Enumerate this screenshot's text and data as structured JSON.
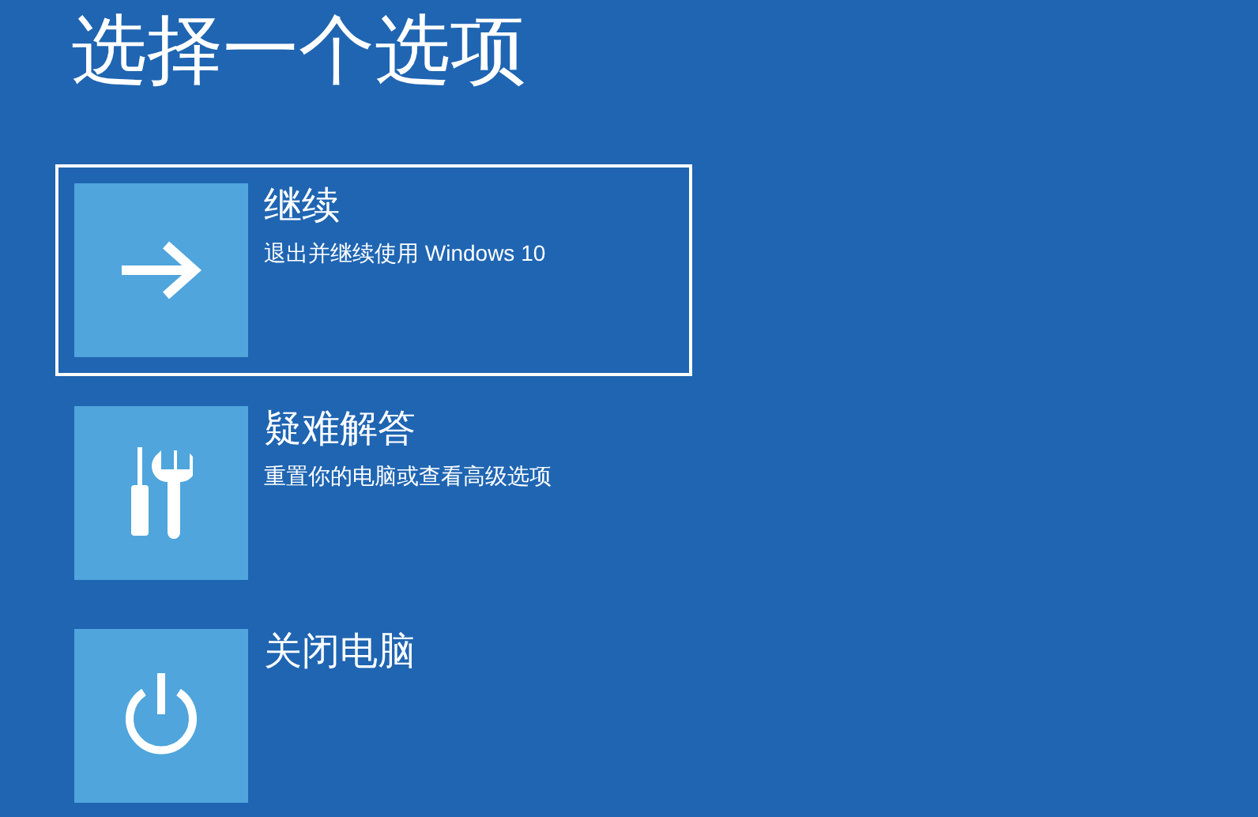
{
  "title": "选择一个选项",
  "options": [
    {
      "kind": "continue",
      "title": "继续",
      "subtitle": "退出并继续使用 Windows 10",
      "selected": true
    },
    {
      "kind": "troubleshoot",
      "title": "疑难解答",
      "subtitle": "重置你的电脑或查看高级选项",
      "selected": false
    },
    {
      "kind": "power",
      "title": "关闭电脑",
      "selected": false
    }
  ]
}
